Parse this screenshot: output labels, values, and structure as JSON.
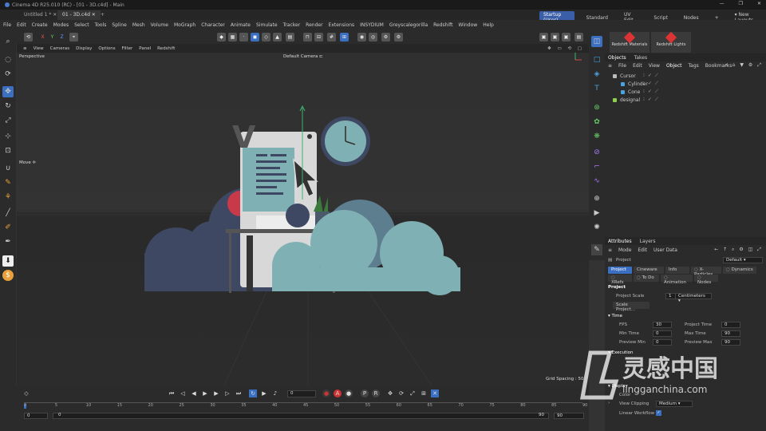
{
  "window": {
    "title": "Cinema 4D R25.010 (RC) - [01 - 3D.c4d] - Main"
  },
  "doc_tabs": [
    {
      "label": "Untitled 1 *"
    },
    {
      "label": "01 - 3D.c4d"
    }
  ],
  "layout_tabs": [
    "Startup (User)",
    "Standard",
    "UV Edit",
    "Script",
    "Nodes"
  ],
  "new_layouts": "New Layouts",
  "menu": [
    "File",
    "Edit",
    "Create",
    "Modes",
    "Select",
    "Tools",
    "Spline",
    "Mesh",
    "Volume",
    "MoGraph",
    "Character",
    "Animate",
    "Simulate",
    "Tracker",
    "Render",
    "Extensions",
    "INSYDIUM",
    "Greyscalegorilla",
    "Redshift",
    "Window",
    "Help"
  ],
  "viewport": {
    "menu": [
      "View",
      "Cameras",
      "Display",
      "Options",
      "Filter",
      "Panel",
      "Redshift"
    ],
    "label": "Perspective",
    "camera": "Default Camera",
    "move_label": "Move",
    "grid_spacing": "Grid Spacing : 50"
  },
  "redshift_buttons": [
    "Redshift Materials",
    "Redshift Lights"
  ],
  "objects_panel": {
    "tabs": [
      "Objects",
      "Takes"
    ],
    "menu": [
      "File",
      "Edit",
      "View",
      "Object",
      "Tags",
      "Bookmarks"
    ],
    "items": [
      {
        "name": "Cursor",
        "indent": 0,
        "color": "#bbbbbb"
      },
      {
        "name": "Cylinder",
        "indent": 1,
        "color": "#4aa3df"
      },
      {
        "name": "Cone",
        "indent": 1,
        "color": "#4aa3df"
      },
      {
        "name": "designal",
        "indent": 0,
        "color": "#8fd14f"
      }
    ]
  },
  "attributes": {
    "tabs": [
      "Attributes",
      "Layers"
    ],
    "menu": [
      "Mode",
      "Edit",
      "User Data"
    ],
    "object_label": "Project",
    "preset": "Default",
    "tab_row1": [
      "Project",
      "Cineware",
      "Info",
      "X-Particles",
      "Dynamics"
    ],
    "tab_row2": [
      "XRefs",
      "To Do",
      "Animation",
      "Nodes"
    ],
    "section_title": "Project",
    "project_scale_label": "Project Scale",
    "project_scale_value": "1",
    "project_scale_unit": "Centimeters",
    "scale_project_button": "Scale Project...",
    "time_section": "Time",
    "fps_label": "FPS",
    "fps_value": "30",
    "project_time_label": "Project Time",
    "project_time_value": "0",
    "min_time_label": "Min Time",
    "min_time_value": "0",
    "max_time_label": "Max Time",
    "max_time_value": "90",
    "preview_min_label": "Preview Min",
    "preview_min_value": "0",
    "preview_max_label": "Preview Max",
    "preview_max_value": "90",
    "execution_section": "Execution",
    "display_section": "Display",
    "color_label": "Color",
    "view_clipping_label": "View Clipping",
    "view_clipping_value": "Medium",
    "linear_workflow_label": "Linear Workflow"
  },
  "timeline": {
    "current_frame": "0",
    "ticks": [
      "0",
      "5",
      "10",
      "15",
      "20",
      "25",
      "30",
      "35",
      "40",
      "45",
      "50",
      "55",
      "60",
      "65",
      "70",
      "75",
      "80",
      "85",
      "90"
    ],
    "range_start": "0",
    "range_start2": "0",
    "range_end": "90",
    "range_end2": "90"
  },
  "watermark": {
    "cn": "灵感中国",
    "url": "lingganchina.com"
  },
  "colors": {
    "accent": "#3b6fc2",
    "cloud_dark": "#3e4863",
    "cloud_light": "#7fb0b3",
    "red": "#c8394a",
    "paper": "#d8d8d8"
  }
}
